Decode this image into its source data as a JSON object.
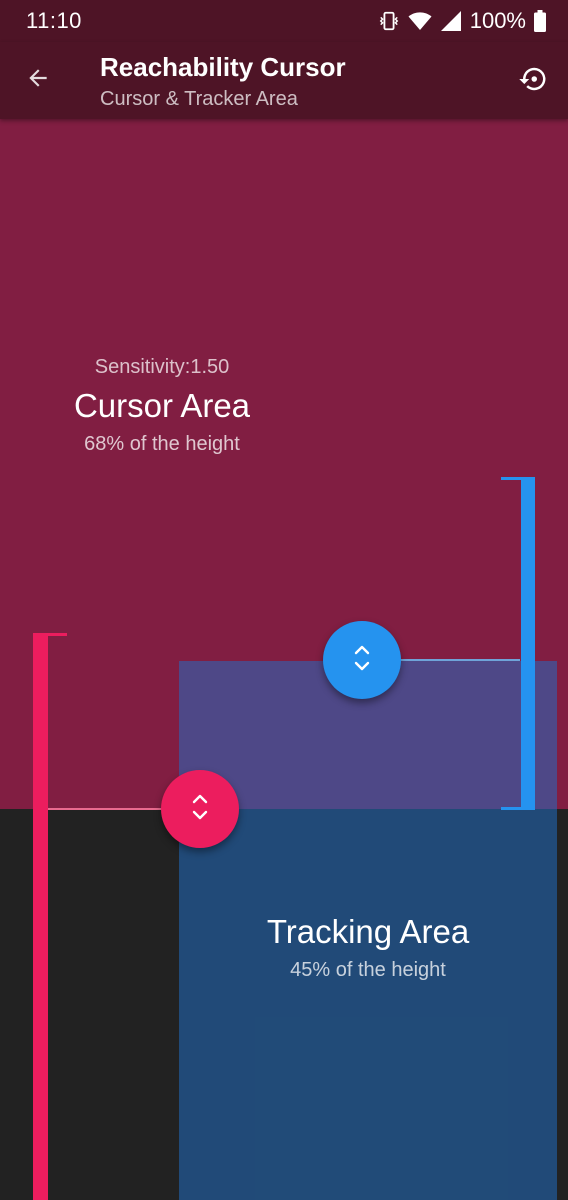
{
  "status_bar": {
    "time": "11:10",
    "battery_percent": "100%",
    "icons": [
      "vibrate-icon",
      "wifi-icon",
      "signal-icon",
      "battery-icon"
    ]
  },
  "app_bar": {
    "title": "Reachability Cursor",
    "subtitle": "Cursor & Tracker Area",
    "back_icon": "arrow-back-icon",
    "action_icon": "restore-icon"
  },
  "cursor_area": {
    "sensitivity": "Sensitivity:1.50",
    "title": "Cursor Area",
    "height_label": "68% of the height",
    "height_fraction": 0.68
  },
  "tracking_area": {
    "title": "Tracking Area",
    "height_label": "45% of the height",
    "height_fraction": 0.45
  },
  "handles": {
    "cursor_handle_icon": "resize-vertical-icon",
    "tracking_handle_icon": "resize-vertical-icon"
  },
  "colors": {
    "toolbar": "#4e1426",
    "cursor_area": "#811e42",
    "tracking_area": "#2170c7",
    "background": "#222222",
    "accent_blue": "#2593ef",
    "accent_pink": "#ec1d5e"
  }
}
